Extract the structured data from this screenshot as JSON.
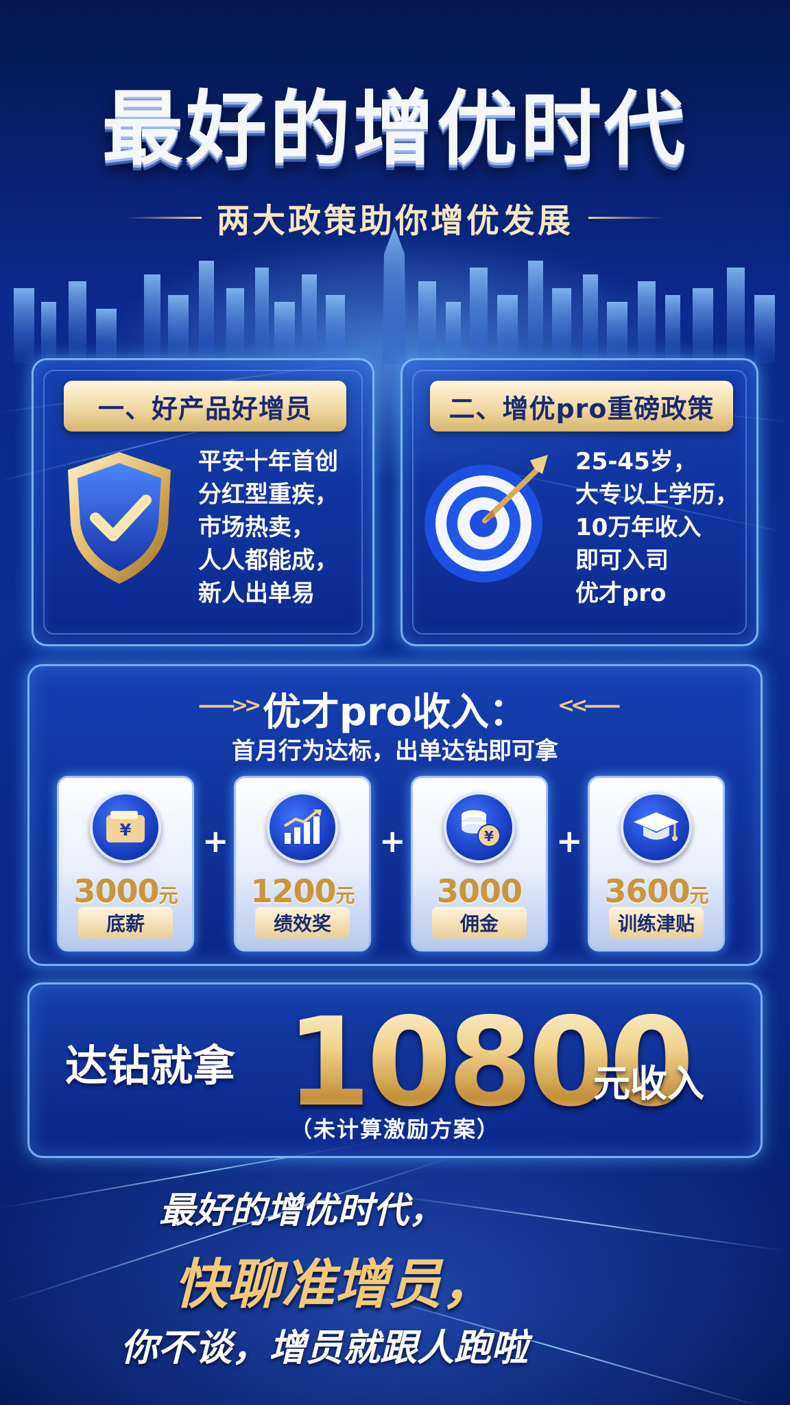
{
  "header": {
    "title": "最好的增优时代",
    "subtitle": "两大政策助你增优发展"
  },
  "policies": [
    {
      "tag": "一、好产品好增员",
      "icon": "shield-check-icon",
      "lines": [
        "平安十年首创",
        "分红型重疾，",
        "市场热卖，",
        "人人都能成，",
        "新人出单易"
      ]
    },
    {
      "tag": "二、增优pro重磅政策",
      "icon": "target-arrow-icon",
      "lines": [
        "25-45岁，",
        "大专以上学历，",
        "10万年收入",
        "即可入司",
        "优才pro"
      ]
    }
  ],
  "income": {
    "title": "优才pro收入：",
    "subtitle": "首月行为达标，出单达钻即可拿",
    "items": [
      {
        "icon": "wallet-yuan-icon",
        "amount": "3000",
        "unit": "元",
        "label": "底薪"
      },
      {
        "icon": "growth-chart-icon",
        "amount": "1200",
        "unit": "元",
        "label": "绩效奖"
      },
      {
        "icon": "coins-yuan-icon",
        "amount": "3000",
        "unit": "",
        "label": "佣金"
      },
      {
        "icon": "graduation-cap-icon",
        "amount": "3600",
        "unit": "元",
        "label": "训练津贴"
      }
    ],
    "plus": "+"
  },
  "total": {
    "prefix": "达钻就拿",
    "amount": "10800",
    "suffix": "元收入",
    "note": "（未计算激励方案）"
  },
  "slogans": {
    "line1": "最好的增优时代，",
    "line2": "快聊准增员，",
    "line3": "你不谈，增员就跟人跑啦"
  },
  "colors": {
    "background": "#0a2b8c",
    "gold": "#e8c47a",
    "accent_blue": "#1438b8"
  }
}
